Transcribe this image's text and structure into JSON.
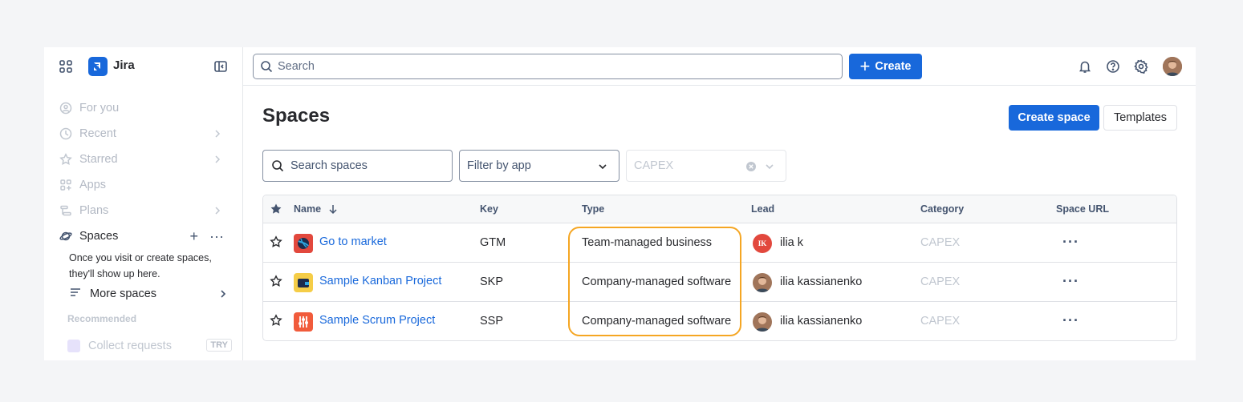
{
  "sidebar": {
    "brand": "Jira",
    "items": [
      {
        "label": "For you"
      },
      {
        "label": "Recent"
      },
      {
        "label": "Starred"
      },
      {
        "label": "Apps"
      },
      {
        "label": "Plans"
      }
    ],
    "spaces_label": "Spaces",
    "spaces_note": "Once you visit or create spaces, they'll show up here.",
    "more_spaces": "More spaces",
    "recommended": "Recommended",
    "collect_requests": "Collect requests",
    "try_badge": "TRY"
  },
  "topbar": {
    "search_placeholder": "Search",
    "create_label": "Create"
  },
  "main": {
    "title": "Spaces",
    "create_space": "Create space",
    "templates": "Templates",
    "search_spaces_placeholder": "Search spaces",
    "filter_by_app": "Filter by app",
    "category_filter": "CAPEX"
  },
  "table": {
    "columns": {
      "name": "Name",
      "key": "Key",
      "type": "Type",
      "lead": "Lead",
      "category": "Category",
      "url": "Space URL"
    },
    "rows": [
      {
        "name": "Go to market",
        "key": "GTM",
        "type": "Team-managed business",
        "lead": "ilia k",
        "lead_initials": "IK",
        "category": "CAPEX",
        "icon_color": "#e2483d"
      },
      {
        "name": "Sample Kanban Project",
        "key": "SKP",
        "type": "Company-managed software",
        "lead": "ilia kassianenko",
        "category": "CAPEX",
        "icon_color": "#f5cd47"
      },
      {
        "name": "Sample Scrum Project",
        "key": "SSP",
        "type": "Company-managed software",
        "lead": "ilia kassianenko",
        "category": "CAPEX",
        "icon_color": "#f15b3b"
      }
    ]
  },
  "colors": {
    "accent": "#1868db",
    "highlight": "#f5a623"
  }
}
